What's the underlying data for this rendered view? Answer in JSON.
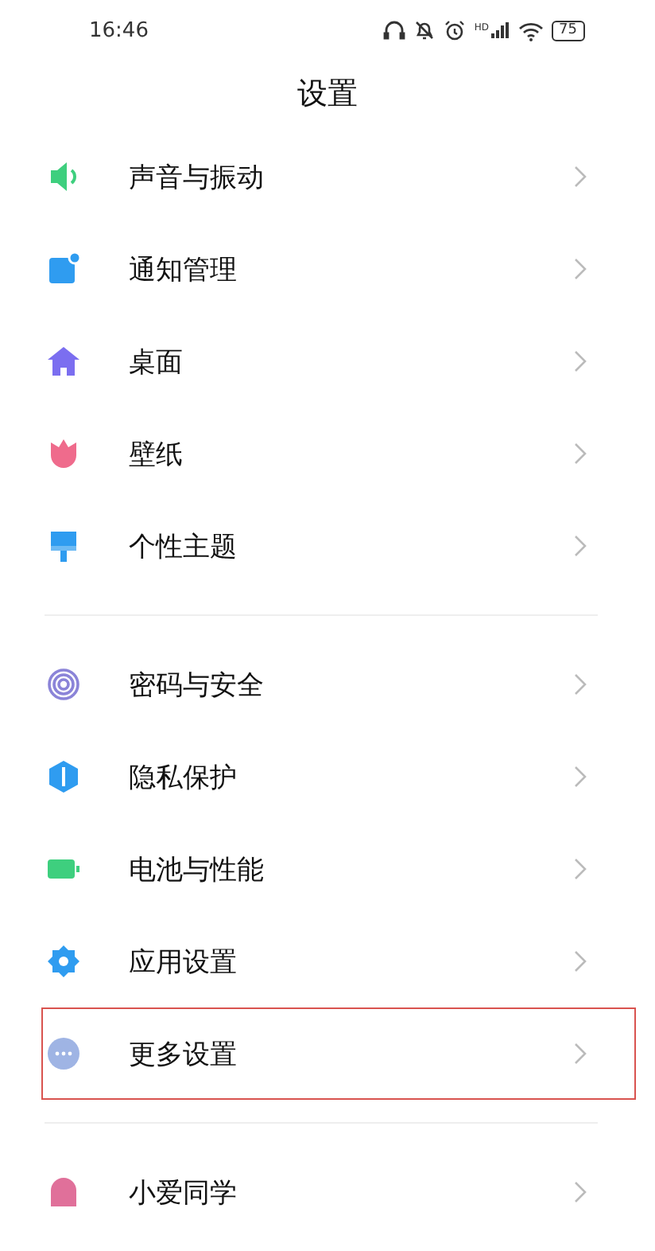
{
  "status_bar": {
    "time": "16:46",
    "network_label": "HD",
    "battery": "75"
  },
  "title": "设置",
  "sections": [
    {
      "items": [
        {
          "label": "声音与振动",
          "kind": "sound",
          "color": "#3ecf7e",
          "highlighted": false
        },
        {
          "label": "通知管理",
          "kind": "notify",
          "color": "#2f9cf0",
          "highlighted": false
        },
        {
          "label": "桌面",
          "kind": "home",
          "color": "#7b6ef0",
          "highlighted": false
        },
        {
          "label": "壁纸",
          "kind": "tulip",
          "color": "#ef6b8c",
          "highlighted": false
        },
        {
          "label": "个性主题",
          "kind": "brush",
          "color": "#2f9cf0",
          "highlighted": false
        }
      ]
    },
    {
      "items": [
        {
          "label": "密码与安全",
          "kind": "fingerprint",
          "color": "#8b84d8",
          "highlighted": false
        },
        {
          "label": "隐私保护",
          "kind": "shield",
          "color": "#2f9cf0",
          "highlighted": false
        },
        {
          "label": "电池与性能",
          "kind": "battery",
          "color": "#3ecf7e",
          "highlighted": false
        },
        {
          "label": "应用设置",
          "kind": "gear",
          "color": "#2f9cf0",
          "highlighted": false
        },
        {
          "label": "更多设置",
          "kind": "more",
          "color": "#9fb4e4",
          "highlighted": true
        }
      ]
    },
    {
      "items": [
        {
          "label": "小爱同学",
          "kind": "assistant",
          "color": "#e0709a",
          "highlighted": false
        }
      ]
    }
  ]
}
